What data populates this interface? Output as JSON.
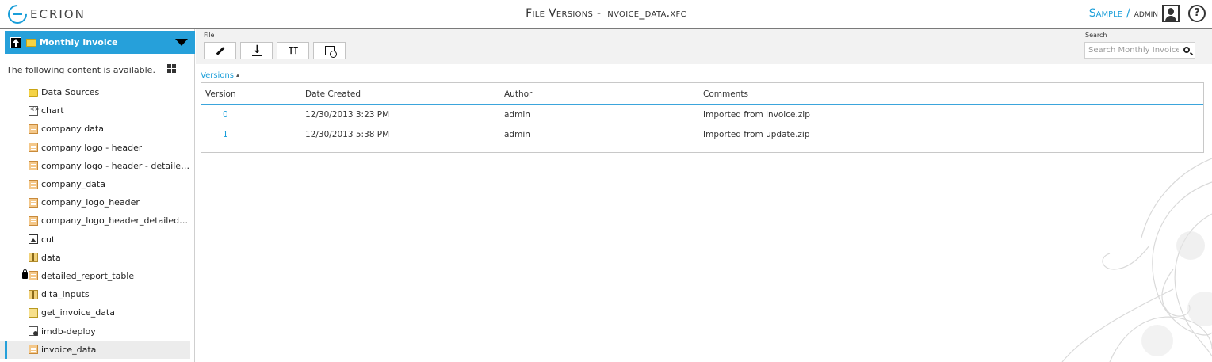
{
  "header": {
    "logo_text": "ECRION",
    "title": "File Versions - invoice_data.xfc",
    "workspace_link": "Sample",
    "separator": "/",
    "username": "admin",
    "help_label": "?"
  },
  "sidebar": {
    "folder_title": "Monthly Invoice",
    "available_text": "The following content is available.",
    "items": [
      {
        "label": "Data Sources",
        "icon": "folder-icon",
        "locked": false,
        "selected": false
      },
      {
        "label": "chart",
        "icon": "code-file-icon",
        "locked": false,
        "selected": false
      },
      {
        "label": "company data",
        "icon": "document-icon",
        "locked": false,
        "selected": false
      },
      {
        "label": "company logo - header",
        "icon": "document-icon",
        "locked": false,
        "selected": false
      },
      {
        "label": "company logo - header - detailed rep...",
        "icon": "document-icon",
        "locked": false,
        "selected": false
      },
      {
        "label": "company_data",
        "icon": "document-icon",
        "locked": false,
        "selected": false
      },
      {
        "label": "company_logo_header",
        "icon": "document-icon",
        "locked": false,
        "selected": false
      },
      {
        "label": "company_logo_header_detailed_report",
        "icon": "document-icon",
        "locked": false,
        "selected": false
      },
      {
        "label": "cut",
        "icon": "image-icon",
        "locked": false,
        "selected": false
      },
      {
        "label": "data",
        "icon": "zip-icon",
        "locked": false,
        "selected": false
      },
      {
        "label": "detailed_report_table",
        "icon": "document-icon",
        "locked": true,
        "selected": false
      },
      {
        "label": "dita_inputs",
        "icon": "zip-icon",
        "locked": false,
        "selected": false
      },
      {
        "label": "get_invoice_data",
        "icon": "script-icon",
        "locked": false,
        "selected": false
      },
      {
        "label": "imdb-deploy",
        "icon": "deploy-icon",
        "locked": false,
        "selected": false
      },
      {
        "label": "invoice_data",
        "icon": "document-icon",
        "locked": false,
        "selected": true
      }
    ]
  },
  "toolbar": {
    "group_label": "File",
    "buttons": [
      {
        "name": "edit-button",
        "icon": "pencil-icon"
      },
      {
        "name": "download-button",
        "icon": "download-icon"
      },
      {
        "name": "tools-button",
        "icon": "tools-icon"
      },
      {
        "name": "history-button",
        "icon": "history-icon"
      }
    ],
    "search_label": "Search",
    "search_placeholder": "Search Monthly Invoice",
    "search_value": ""
  },
  "versions": {
    "tab_label": "Versions",
    "columns": [
      "Version",
      "Date Created",
      "Author",
      "Comments"
    ],
    "rows": [
      {
        "version": "0",
        "date": "12/30/2013 3:23 PM",
        "author": "admin",
        "comment": "Imported from invoice.zip"
      },
      {
        "version": "1",
        "date": "12/30/2013 5:38 PM",
        "author": "admin",
        "comment": "Imported from update.zip"
      }
    ]
  },
  "colors": {
    "accent": "#26a0da",
    "link": "#1a9ed9",
    "toolbar_bg": "#f2f2f2",
    "selected_bg": "#ececec"
  }
}
